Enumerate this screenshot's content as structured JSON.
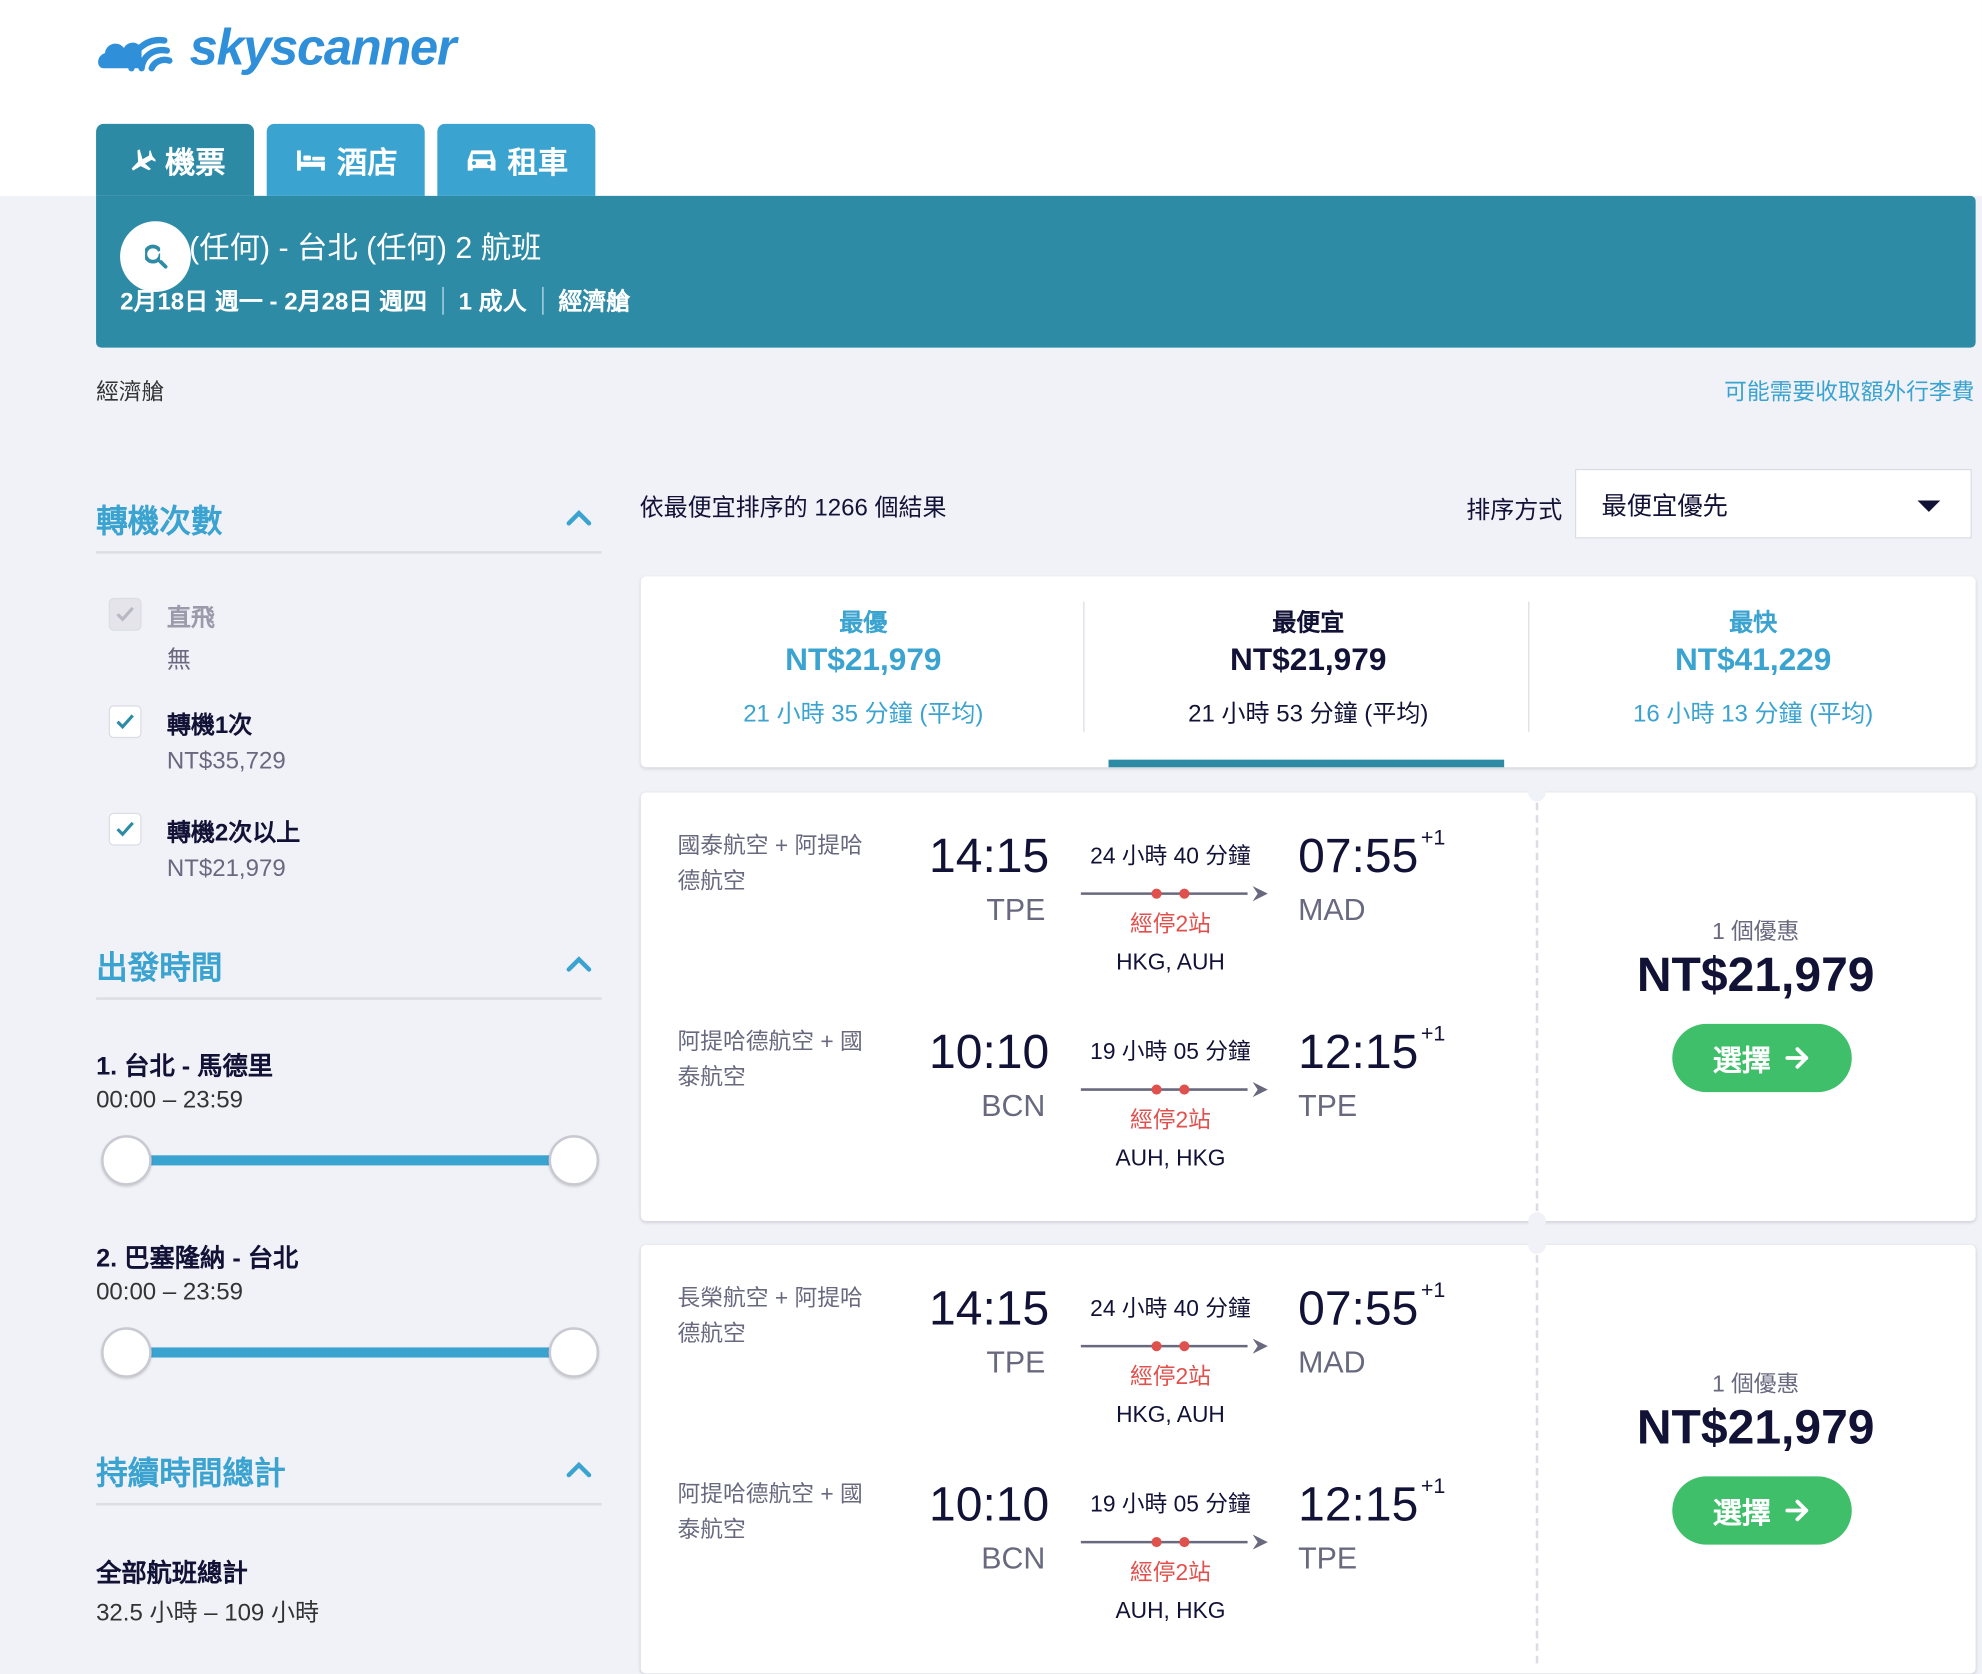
{
  "brand": {
    "name": "skyscanner",
    "color": "#2f8fd8"
  },
  "tabs": [
    {
      "label": "機票",
      "icon": "plane-icon",
      "active": true
    },
    {
      "label": "酒店",
      "icon": "bed-icon",
      "active": false
    },
    {
      "label": "租車",
      "icon": "car-icon",
      "active": false
    }
  ],
  "search": {
    "title": "台北 (任何) - 台北 (任何) 2 航班",
    "dates": "2月18日 週一 - 2月28日 週四",
    "travellers": "1 成人",
    "cabin": "經濟艙"
  },
  "cabin_label": "經濟艙",
  "bag_notice": "可能需要收取額外行李費",
  "filters": {
    "stops": {
      "title": "轉機次數",
      "options": [
        {
          "label": "直飛",
          "price": "無",
          "checked": true,
          "disabled": true
        },
        {
          "label": "轉機1次",
          "price": "NT$35,729",
          "checked": true,
          "disabled": false
        },
        {
          "label": "轉機2次以上",
          "price": "NT$21,979",
          "checked": true,
          "disabled": false
        }
      ]
    },
    "departure": {
      "title": "出發時間",
      "legs": [
        {
          "label": "1. 台北 - 馬德里",
          "range": "00:00 – 23:59",
          "min": 0,
          "max": 1
        },
        {
          "label": "2. 巴塞隆納 - 台北",
          "range": "00:00 – 23:59",
          "min": 0,
          "max": 1
        }
      ]
    },
    "duration": {
      "title": "持續時間總計",
      "label": "全部航班總計",
      "range": "32.5 小時 – 109 小時"
    }
  },
  "results": {
    "count_text": "依最便宜排序的 1266 個結果",
    "sort_label": "排序方式",
    "sort_value": "最便宜優先"
  },
  "summary": [
    {
      "label": "最優",
      "price": "NT$21,979",
      "duration": "21 小時 35 分鐘 (平均)",
      "active": false
    },
    {
      "label": "最便宜",
      "price": "NT$21,979",
      "duration": "21 小時 53 分鐘 (平均)",
      "active": true
    },
    {
      "label": "最快",
      "price": "NT$41,229",
      "duration": "16 小時 13 分鐘 (平均)",
      "active": false
    }
  ],
  "cards": [
    {
      "legs": [
        {
          "airline": "國泰航空 + 阿提哈德航空",
          "dep_time": "14:15",
          "dep_ap": "TPE",
          "duration": "24 小時 40 分鐘",
          "stops": "經停2站",
          "via": "HKG, AUH",
          "arr_time": "07:55",
          "arr_plus": "+1",
          "arr_ap": "MAD"
        },
        {
          "airline": "阿提哈德航空 + 國泰航空",
          "dep_time": "10:10",
          "dep_ap": "BCN",
          "duration": "19 小時 05 分鐘",
          "stops": "經停2站",
          "via": "AUH, HKG",
          "arr_time": "12:15",
          "arr_plus": "+1",
          "arr_ap": "TPE"
        }
      ],
      "deals": "1 個優惠",
      "price": "NT$21,979",
      "select": "選擇"
    },
    {
      "legs": [
        {
          "airline": "長榮航空 + 阿提哈德航空",
          "dep_time": "14:15",
          "dep_ap": "TPE",
          "duration": "24 小時 40 分鐘",
          "stops": "經停2站",
          "via": "HKG, AUH",
          "arr_time": "07:55",
          "arr_plus": "+1",
          "arr_ap": "MAD"
        },
        {
          "airline": "阿提哈德航空 + 國泰航空",
          "dep_time": "10:10",
          "dep_ap": "BCN",
          "duration": "19 小時 05 分鐘",
          "stops": "經停2站",
          "via": "AUH, HKG",
          "arr_time": "12:15",
          "arr_plus": "+1",
          "arr_ap": "TPE"
        }
      ],
      "deals": "1 個優惠",
      "price": "NT$21,979",
      "select": "選擇"
    }
  ],
  "colors": {
    "primary": "#2e8ba6",
    "accent": "#3aa3d0",
    "stops": "#e0504c",
    "select": "#3fbf6a"
  }
}
